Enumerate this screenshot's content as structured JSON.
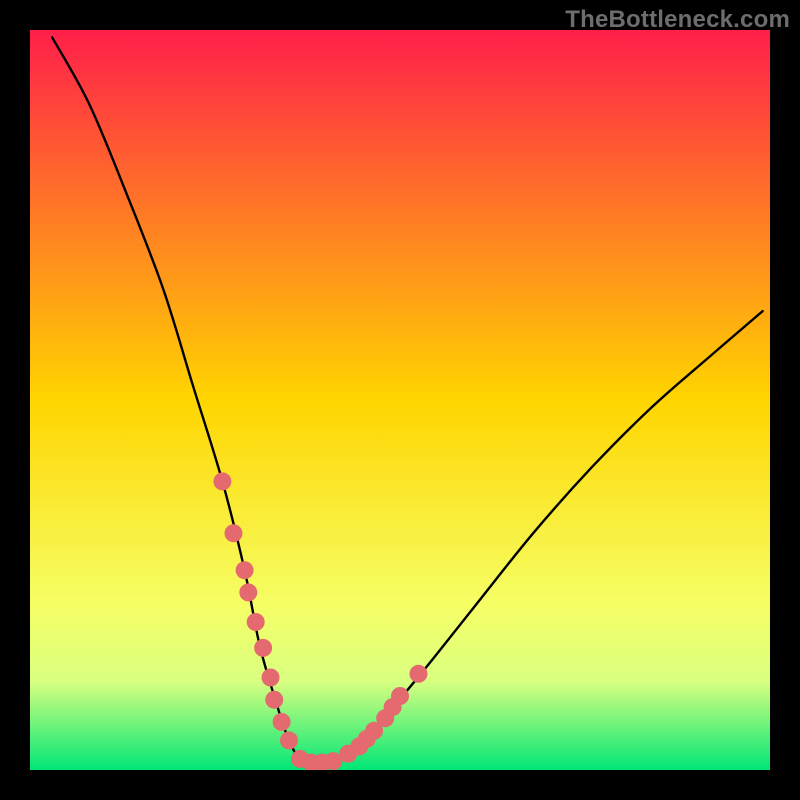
{
  "watermark": "TheBottleneck.com",
  "colors": {
    "bg": "#000000",
    "grad_top": "#ff1f4a",
    "grad_mid": "#ffd500",
    "grad_low1": "#f5ff66",
    "grad_low2": "#d9ff80",
    "grad_bot": "#00e676",
    "curve": "#000000",
    "dot": "#e46a6f"
  },
  "chart_data": {
    "type": "line",
    "title": "",
    "xlabel": "",
    "ylabel": "",
    "xlim": [
      0,
      100
    ],
    "ylim": [
      0,
      100
    ],
    "grid": false,
    "xticks": [],
    "yticks": [],
    "series": [
      {
        "name": "main-curve",
        "x": [
          3,
          8,
          13,
          18,
          22,
          26,
          29,
          31,
          33,
          35,
          37,
          40,
          45,
          52,
          60,
          68,
          76,
          84,
          92,
          99
        ],
        "y": [
          99,
          90,
          78,
          65,
          52,
          39,
          27,
          17,
          10,
          4,
          1,
          1,
          4,
          12,
          22,
          32,
          41,
          49,
          56,
          62
        ]
      }
    ],
    "markers": {
      "name": "highlight-dots",
      "x": [
        26.0,
        27.5,
        29.0,
        29.5,
        30.5,
        31.5,
        32.5,
        33.0,
        34.0,
        35.0,
        36.5,
        38.0,
        39.5,
        41.0,
        43.0,
        44.5,
        45.5,
        46.5,
        48.0,
        49.0,
        50.0,
        52.5
      ],
      "y": [
        39.0,
        32.0,
        27.0,
        24.0,
        20.0,
        16.5,
        12.5,
        9.5,
        6.5,
        4.0,
        1.5,
        1.0,
        1.0,
        1.2,
        2.2,
        3.2,
        4.2,
        5.3,
        7.0,
        8.5,
        10.0,
        13.0
      ]
    },
    "gradient_stops": [
      {
        "pos": 0.0,
        "key": "grad_top"
      },
      {
        "pos": 0.5,
        "key": "grad_mid"
      },
      {
        "pos": 0.78,
        "key": "grad_low1"
      },
      {
        "pos": 0.88,
        "key": "grad_low2"
      },
      {
        "pos": 1.0,
        "key": "grad_bot"
      }
    ]
  }
}
